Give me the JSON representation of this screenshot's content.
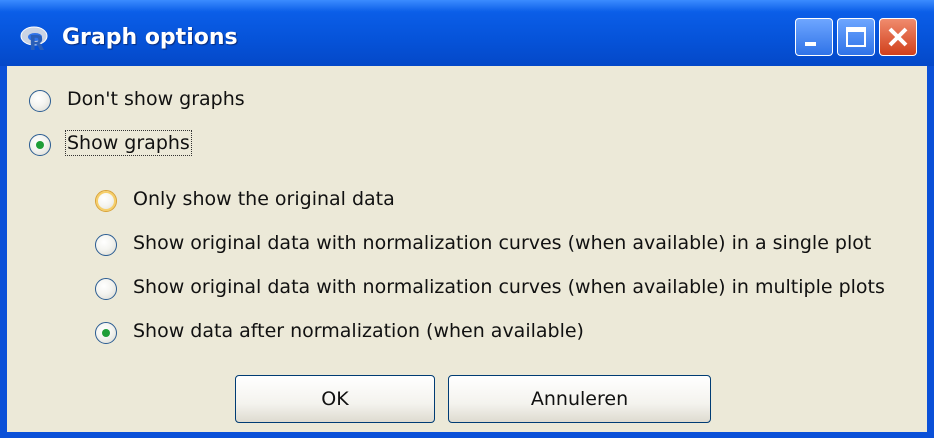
{
  "window": {
    "title": "Graph options",
    "app_icon": "R-logo-icon"
  },
  "titlebar_buttons": {
    "minimize": "minimize-icon",
    "maximize": "maximize-icon",
    "close": "close-icon"
  },
  "options": {
    "dont_show": {
      "label": "Don't show graphs",
      "checked": false
    },
    "show": {
      "label": "Show graphs",
      "checked": true
    },
    "sub": [
      {
        "label": "Only show the original data",
        "checked": false
      },
      {
        "label": "Show original data with normalization curves (when available) in a single plot",
        "checked": false
      },
      {
        "label": "Show original data with normalization curves (when available) in multiple plots",
        "checked": false
      },
      {
        "label": "Show data after normalization (when available)",
        "checked": true
      }
    ]
  },
  "buttons": {
    "ok": "OK",
    "cancel": "Annuleren"
  },
  "colors": {
    "titlebar": "#0653d9",
    "client": "#ece9d8",
    "radio_selected": "#1f9e38"
  }
}
